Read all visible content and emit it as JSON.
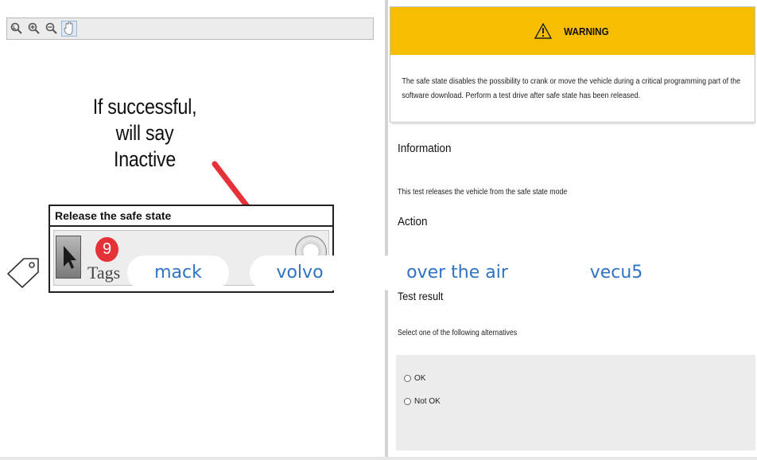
{
  "left": {
    "toolbar": {
      "tools": [
        "select-zoom-icon",
        "zoom-in-icon",
        "zoom-out-icon",
        "hand-pan-icon"
      ]
    },
    "annotation_lines": [
      "If successful,",
      "will say",
      "Inactive"
    ],
    "panel": {
      "title": "Release the safe state",
      "step_number": "9"
    }
  },
  "right": {
    "warning": {
      "title": "WARNING",
      "text": "The safe state disables the possibility to crank or move the vehicle during a critical programming part of the software download. Perform a test drive after safe state has been released."
    },
    "information": {
      "heading": "Information",
      "text": "This test releases the vehicle from the safe state mode"
    },
    "action": {
      "heading": "Action"
    },
    "test_result": {
      "heading": "Test result",
      "prompt": "Select one of the following alternatives",
      "options": [
        "OK",
        "Not OK"
      ]
    }
  },
  "tags": {
    "label": "Tags",
    "items": [
      "mack",
      "volvo",
      "over the air",
      "vecu5"
    ]
  },
  "colors": {
    "warning_bar": "#f7be00",
    "tag_text": "#2f73c5",
    "annotation_arrow": "#e53138"
  }
}
